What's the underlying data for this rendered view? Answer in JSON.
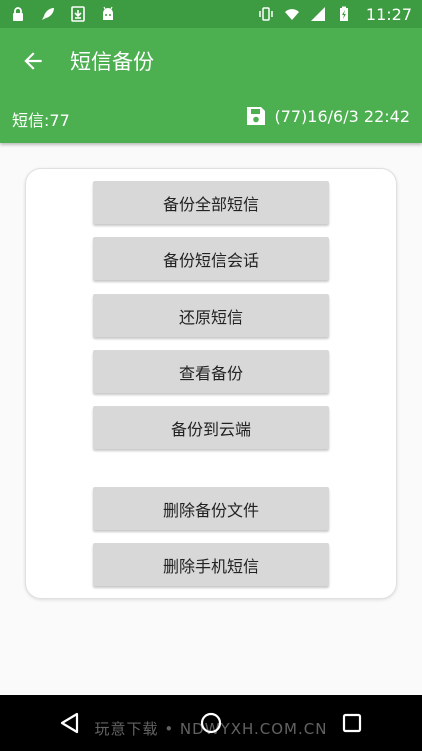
{
  "status_bar": {
    "time": "11:27",
    "left_icons": [
      "lock-icon",
      "rocket-icon",
      "download-icon",
      "android-icon"
    ],
    "right_icons": [
      "vibrate-icon",
      "wifi-icon",
      "cell-signal-icon",
      "battery-charging-icon"
    ]
  },
  "app_bar": {
    "title": "短信备份",
    "sms_count": "短信:77",
    "last_backup": "(77)16/6/3 22:42",
    "icons": [
      "back-arrow-icon",
      "save-icon"
    ]
  },
  "actions": {
    "backup_all": "备份全部短信",
    "backup_conversations": "备份短信会话",
    "restore": "还原短信",
    "view_backup": "查看备份",
    "backup_cloud": "备份到云端",
    "delete_backup_file": "删除备份文件",
    "delete_phone_sms": "删除手机短信"
  },
  "navigation": {
    "icons": [
      "nav-back-icon",
      "nav-home-icon",
      "nav-recents-icon"
    ]
  },
  "watermark": "玩意下载 • NDWYXH.COM.CN",
  "colors": {
    "status_bar": "#3d9c41",
    "app_bar": "#4caf50",
    "button": "#d8d8d8",
    "nav_bar": "#000000"
  }
}
